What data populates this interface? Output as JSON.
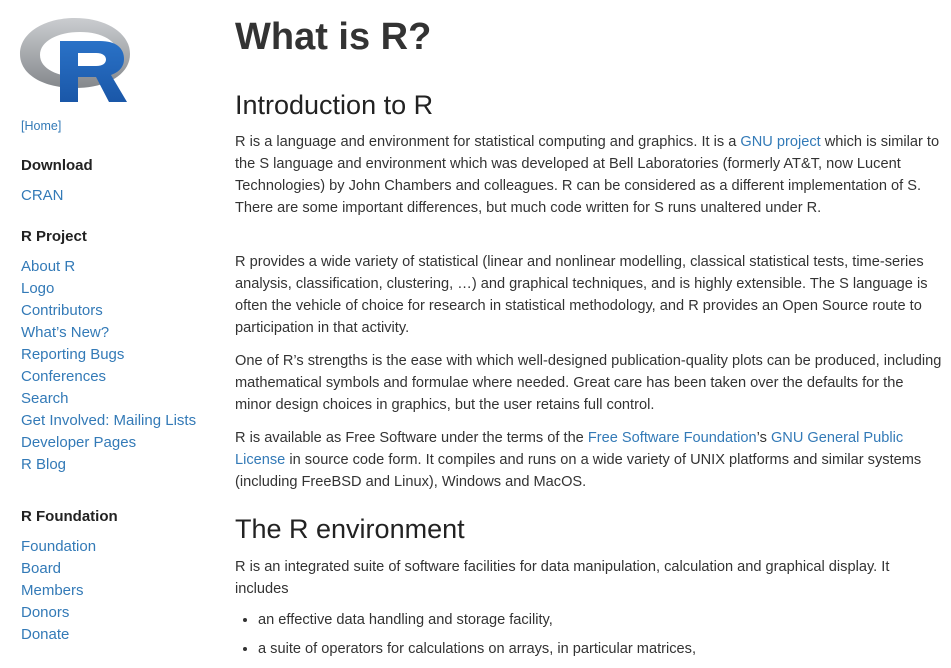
{
  "sidebar": {
    "logo_letter": "R",
    "home_label": "[Home]",
    "sections": [
      {
        "heading": "Download",
        "items": [
          "CRAN"
        ]
      },
      {
        "heading": "R Project",
        "items": [
          "About R",
          "Logo",
          "Contributors",
          "What’s New?",
          "Reporting Bugs",
          "Conferences",
          "Search",
          "Get Involved: Mailing Lists",
          "Developer Pages",
          "R Blog"
        ]
      },
      {
        "heading": "R Foundation",
        "items": [
          "Foundation",
          "Board",
          "Members",
          "Donors",
          "Donate"
        ]
      }
    ]
  },
  "main": {
    "title": "What is R?",
    "intro_heading": "Introduction to R",
    "p1": {
      "before_link": "R is a language and environment for statistical computing and graphics. It is a ",
      "link": "GNU project",
      "after_link": " which is similar to the S language and environment which was developed at Bell Laboratories (formerly AT&T, now Lucent Technologies) by John Chambers and colleagues. R can be considered as a different implementation of S. There are some important differences, but much code written for S runs unaltered under R."
    },
    "p2": "R provides a wide variety of statistical (linear and nonlinear modelling, classical statistical tests, time-series analysis, classification, clustering, …) and graphical techniques, and is highly extensible. The S language is often the vehicle of choice for research in statistical methodology, and R provides an Open Source route to participation in that activity.",
    "p3": "One of R’s strengths is the ease with which well-designed publication-quality plots can be produced, including mathematical symbols and formulae where needed. Great care has been taken over the defaults for the minor design choices in graphics, but the user retains full control.",
    "p4": {
      "before_link1": "R is available as Free Software under the terms of the ",
      "link1": "Free Software Foundation",
      "between": "’s ",
      "link2": "GNU General Public License",
      "after_link2": " in source code form. It compiles and runs on a wide variety of UNIX platforms and similar systems (including FreeBSD and Linux), Windows and MacOS."
    },
    "env_heading": "The R environment",
    "p5": "R is an integrated suite of software facilities for data manipulation, calculation and graphical display. It includes",
    "bullets": [
      "an effective data handling and storage facility,",
      "a suite of operators for calculations on arrays, in particular matrices,"
    ]
  },
  "colors": {
    "link": "#337ab7",
    "text": "#333333",
    "logo_blue": "#2165b6",
    "logo_gray": "#a9abad"
  }
}
